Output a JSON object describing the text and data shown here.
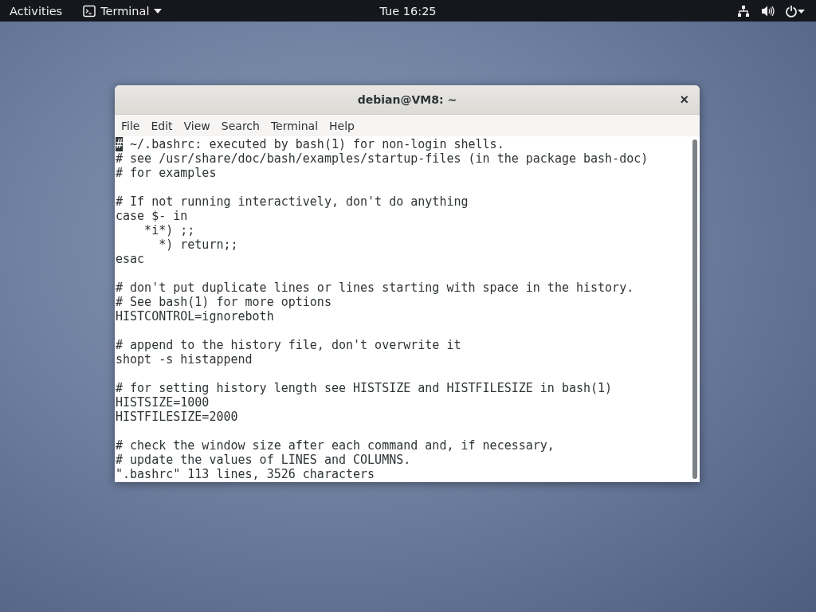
{
  "top_bar": {
    "activities": "Activities",
    "app_menu": "Terminal",
    "clock": "Tue 16:25"
  },
  "window": {
    "title": "debian@VM8: ~",
    "close": "×"
  },
  "menu": [
    "File",
    "Edit",
    "View",
    "Search",
    "Terminal",
    "Help"
  ],
  "terminal": {
    "cursor": true,
    "blocks": [
      [
        "# ~/.bashrc: executed by bash(1) for non-login shells.",
        "# see /usr/share/doc/bash/examples/startup-files (in the package bash-doc)",
        "# for examples"
      ],
      [
        "# If not running interactively, don't do anything",
        "case $- in",
        "    *i*) ;;",
        "      *) return;;",
        "esac"
      ],
      [
        "# don't put duplicate lines or lines starting with space in the history.",
        "# See bash(1) for more options",
        "HISTCONTROL=ignoreboth"
      ],
      [
        "# append to the history file, don't overwrite it",
        "shopt -s histappend"
      ],
      [
        "# for setting history length see HISTSIZE and HISTFILESIZE in bash(1)",
        "HISTSIZE=1000",
        "HISTFILESIZE=2000"
      ],
      [
        "# check the window size after each command and, if necessary,",
        "# update the values of LINES and COLUMNS."
      ]
    ],
    "status_line": "\".bashrc\" 113 lines, 3526 characters"
  }
}
